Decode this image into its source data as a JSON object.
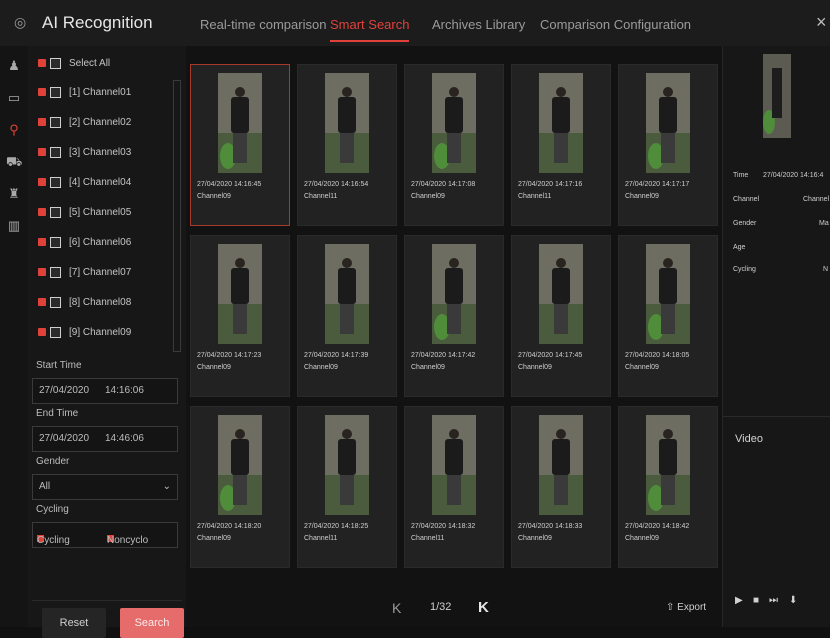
{
  "header": {
    "app_title": "AI Recognition",
    "tabs": [
      {
        "label": "Real-time comparison",
        "active": false
      },
      {
        "label": "Smart Search",
        "active": true
      },
      {
        "label": "Archives Library",
        "active": false
      },
      {
        "label": "Comparison Configuration",
        "active": false
      }
    ],
    "close": "×"
  },
  "sidebar_icons": [
    "person-icon",
    "id-card-icon",
    "cycling-icon",
    "car-icon",
    "walking-icon",
    "storage-icon"
  ],
  "filter": {
    "select_all_label": "Select All",
    "channels": [
      "[1] Channel01",
      "[2] Channel02",
      "[3] Channel03",
      "[4] Channel04",
      "[5] Channel05",
      "[6] Channel06",
      "[7] Channel07",
      "[8] Channel08",
      "[9] Channel09"
    ],
    "start_time_label": "Start Time",
    "start_date": "27/04/2020",
    "start_time": "14:16:06",
    "end_time_label": "End Time",
    "end_date": "27/04/2020",
    "end_time": "14:46:06",
    "gender_label": "Gender",
    "gender_value": "All",
    "cycling_label": "Cycling",
    "cycling_option": "Cycling",
    "noncycling_option": "Noncyclo",
    "reset_label": "Reset",
    "search_label": "Search"
  },
  "results": [
    {
      "time": "27/04/2020 14:16:45",
      "channel": "Channel09",
      "selected": true
    },
    {
      "time": "27/04/2020 14:16:54",
      "channel": "Channel11",
      "selected": false
    },
    {
      "time": "27/04/2020 14:17:08",
      "channel": "Channel09",
      "selected": false
    },
    {
      "time": "27/04/2020 14:17:16",
      "channel": "Channel11",
      "selected": false
    },
    {
      "time": "27/04/2020 14:17:17",
      "channel": "Channel09",
      "selected": false
    },
    {
      "time": "27/04/2020 14:17:23",
      "channel": "Channel09",
      "selected": false
    },
    {
      "time": "27/04/2020 14:17:39",
      "channel": "Channel09",
      "selected": false
    },
    {
      "time": "27/04/2020 14:17:42",
      "channel": "Channel09",
      "selected": false
    },
    {
      "time": "27/04/2020 14:17:45",
      "channel": "Channel09",
      "selected": false
    },
    {
      "time": "27/04/2020 14:18:05",
      "channel": "Channel09",
      "selected": false
    },
    {
      "time": "27/04/2020 14:18:20",
      "channel": "Channel09",
      "selected": false
    },
    {
      "time": "27/04/2020 14:18:25",
      "channel": "Channel11",
      "selected": false
    },
    {
      "time": "27/04/2020 14:18:32",
      "channel": "Channel11",
      "selected": false
    },
    {
      "time": "27/04/2020 14:18:33",
      "channel": "Channel09",
      "selected": false
    },
    {
      "time": "27/04/2020 14:18:42",
      "channel": "Channel09",
      "selected": false
    }
  ],
  "pager": {
    "first": "K",
    "count": "1/32",
    "next": "K",
    "export_label": "Export"
  },
  "detail": {
    "time_label": "Time",
    "time_value": "27/04/2020 14:16:4",
    "channel_label": "Channel",
    "channel_value": "Channel",
    "gender_label": "Gender",
    "gender_value": "Ma",
    "age_label": "Age",
    "cycling_label": "Cycling",
    "cycling_value": "N"
  },
  "video": {
    "title": "Video",
    "controls": [
      "play-icon",
      "stop-icon",
      "next-frame-icon",
      "download-icon"
    ]
  }
}
